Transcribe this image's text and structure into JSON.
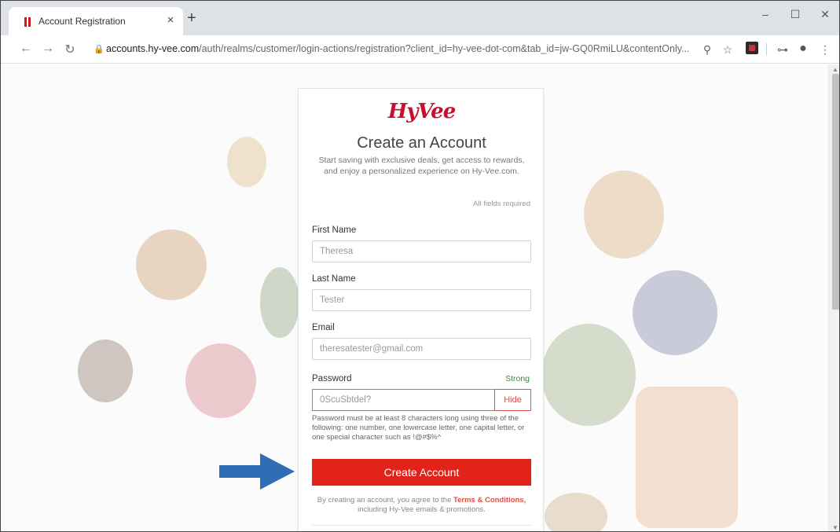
{
  "browser": {
    "tab_title": "Account Registration",
    "tab_close": "×",
    "new_tab": "+",
    "url_host": "accounts.hy-vee.com",
    "url_path": "/auth/realms/customer/login-actions/registration?client_id=hy-vee-dot-com&tab_id=jw-GQ0RmiLU&contentOnly...",
    "win_min": "–",
    "win_max": "☐",
    "win_close": "✕",
    "back": "←",
    "forward": "→",
    "reload": "↻",
    "lock": "🔒",
    "zoom_icon": "⚲",
    "star": "☆",
    "key": "⊶",
    "account": "●",
    "menu": "⋮"
  },
  "form": {
    "logo": "HyVee",
    "title": "Create an Account",
    "subtitle": "Start saving with exclusive deals, get access to rewards, and enjoy a personalized experience on Hy-Vee.com.",
    "required_note": "All fields required",
    "first_name_label": "First Name",
    "first_name_value": "Theresa",
    "last_name_label": "Last Name",
    "last_name_value": "Tester",
    "email_label": "Email",
    "email_value": "theresatester@gmail.com",
    "password_label": "Password",
    "password_strength": "Strong",
    "password_value": "0ScuSbtdel?",
    "hide_label": "Hide",
    "password_help": "Password must be at least 8 characters long using three of the following: one number, one lowercase letter, one capital letter, or one special character such as !@#$%^",
    "create_button": "Create Account",
    "terms_prefix": "By creating an account, you agree to the",
    "terms_link": "Terms & Conditions,",
    "terms_suffix": "including Hy-Vee emails & promotions."
  },
  "colors": {
    "brand_red": "#e2231a",
    "arrow_blue": "#2f6db5",
    "strength_green": "#3a8d3a"
  }
}
